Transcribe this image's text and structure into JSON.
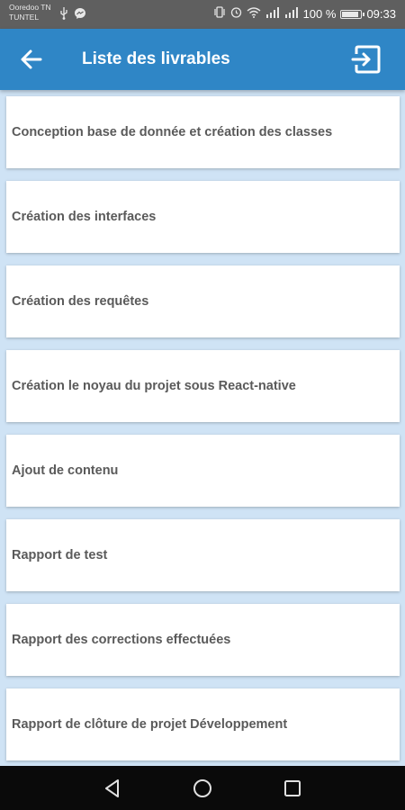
{
  "status_bar": {
    "carrier_line1": "Ooredoo TN",
    "carrier_line2": "TUNTEL",
    "battery_percent": "100 %",
    "time": "09:33",
    "icons": [
      "usb-icon",
      "messenger-icon",
      "vibrate-icon",
      "alarm-icon",
      "wifi-icon",
      "signal-icon",
      "battery-icon"
    ]
  },
  "app_bar": {
    "title": "Liste des livrables",
    "back_icon": "arrow-left-icon",
    "exit_icon": "exit-to-app-icon",
    "color": "#2f86c6"
  },
  "deliverables": [
    {
      "label": "Conception base de donnée et création des classes"
    },
    {
      "label": "Création des interfaces"
    },
    {
      "label": "Création des requêtes"
    },
    {
      "label": "Création le noyau du projet sous React-native"
    },
    {
      "label": "Ajout de contenu"
    },
    {
      "label": "Rapport de test"
    },
    {
      "label": "Rapport des corrections effectuées"
    },
    {
      "label": "Rapport de clôture de projet Développement"
    }
  ],
  "nav_bar": {
    "icons": [
      "nav-back-icon",
      "nav-home-icon",
      "nav-recents-icon"
    ]
  }
}
